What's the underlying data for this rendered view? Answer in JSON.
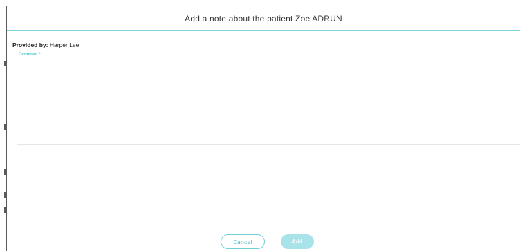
{
  "dialog": {
    "title": "Add a note about the patient Zoe ADRUN",
    "provided_by_label": "Provided by:",
    "provided_by_value": "Harper Lee",
    "comment_label": "Comment *",
    "comment_value": "",
    "cancel_label": "Cancel",
    "add_label": "Add"
  },
  "colors": {
    "accent": "#47c2cf",
    "accent_light": "#a9e3ea",
    "title_underline": "#7fd3dc"
  }
}
